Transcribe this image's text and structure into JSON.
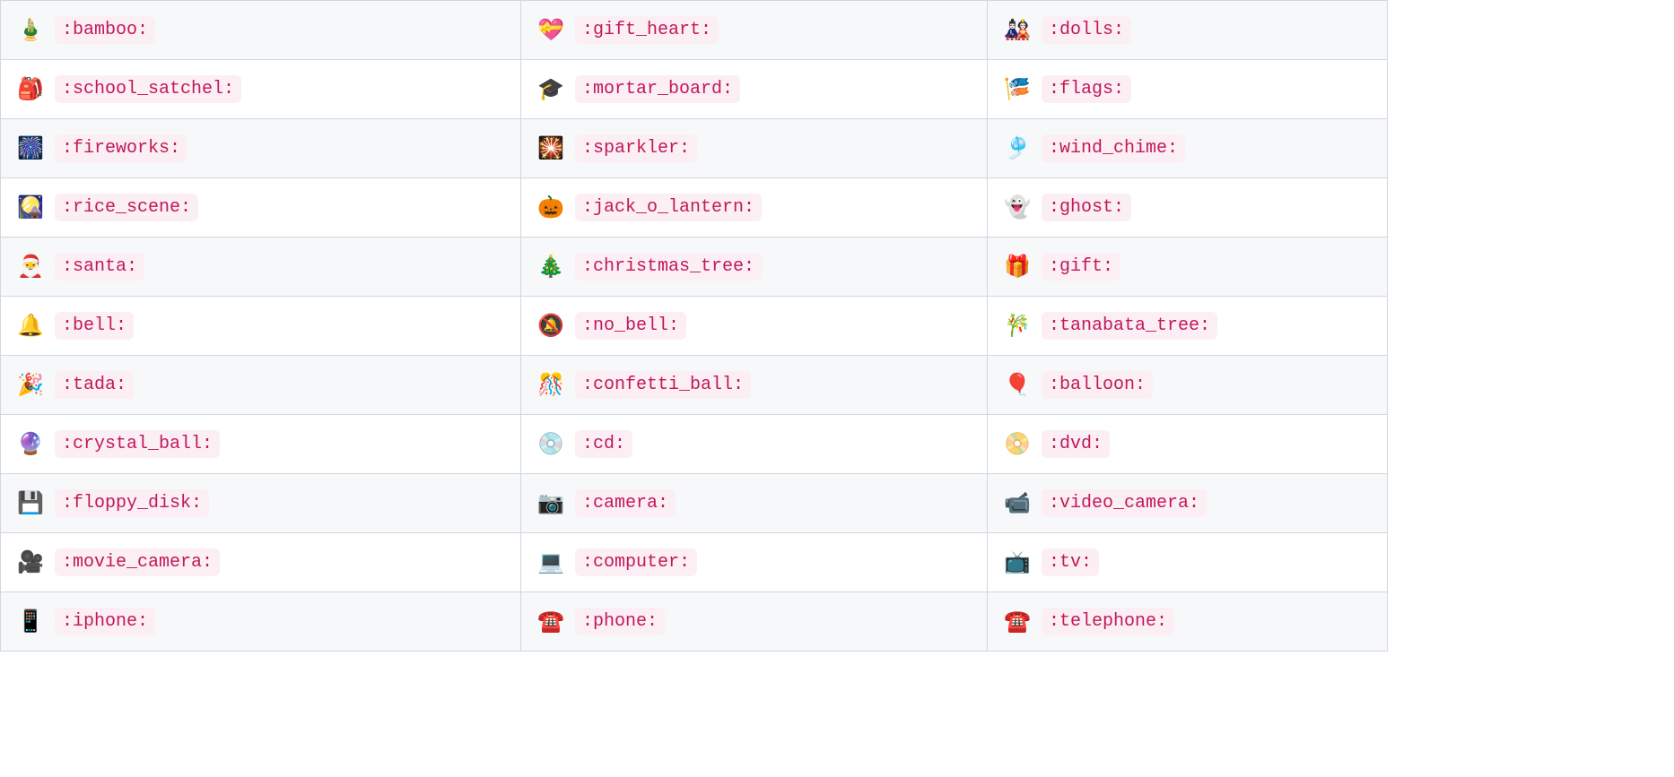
{
  "rows": [
    {
      "shade": "grey",
      "cells": [
        {
          "emoji": "🎍",
          "code": ":bamboo:",
          "name": "bamboo"
        },
        {
          "emoji": "💝",
          "code": ":gift_heart:",
          "name": "gift-heart"
        },
        {
          "emoji": "🎎",
          "code": ":dolls:",
          "name": "dolls"
        }
      ]
    },
    {
      "shade": "white",
      "cells": [
        {
          "emoji": "🎒",
          "code": ":school_satchel:",
          "name": "school-satchel"
        },
        {
          "emoji": "🎓",
          "code": ":mortar_board:",
          "name": "mortar-board"
        },
        {
          "emoji": "🎏",
          "code": ":flags:",
          "name": "flags"
        }
      ]
    },
    {
      "shade": "grey",
      "cells": [
        {
          "emoji": "🎆",
          "code": ":fireworks:",
          "name": "fireworks"
        },
        {
          "emoji": "🎇",
          "code": ":sparkler:",
          "name": "sparkler"
        },
        {
          "emoji": "🎐",
          "code": ":wind_chime:",
          "name": "wind-chime"
        }
      ]
    },
    {
      "shade": "white",
      "cells": [
        {
          "emoji": "🎑",
          "code": ":rice_scene:",
          "name": "rice-scene"
        },
        {
          "emoji": "🎃",
          "code": ":jack_o_lantern:",
          "name": "jack-o-lantern"
        },
        {
          "emoji": "👻",
          "code": ":ghost:",
          "name": "ghost"
        }
      ]
    },
    {
      "shade": "grey",
      "cells": [
        {
          "emoji": "🎅",
          "code": ":santa:",
          "name": "santa"
        },
        {
          "emoji": "🎄",
          "code": ":christmas_tree:",
          "name": "christmas-tree"
        },
        {
          "emoji": "🎁",
          "code": ":gift:",
          "name": "gift"
        }
      ]
    },
    {
      "shade": "white",
      "cells": [
        {
          "emoji": "🔔",
          "code": ":bell:",
          "name": "bell"
        },
        {
          "emoji": "🔕",
          "code": ":no_bell:",
          "name": "no-bell"
        },
        {
          "emoji": "🎋",
          "code": ":tanabata_tree:",
          "name": "tanabata-tree"
        }
      ]
    },
    {
      "shade": "grey",
      "cells": [
        {
          "emoji": "🎉",
          "code": ":tada:",
          "name": "tada"
        },
        {
          "emoji": "🎊",
          "code": ":confetti_ball:",
          "name": "confetti-ball"
        },
        {
          "emoji": "🎈",
          "code": ":balloon:",
          "name": "balloon"
        }
      ]
    },
    {
      "shade": "white",
      "cells": [
        {
          "emoji": "🔮",
          "code": ":crystal_ball:",
          "name": "crystal-ball"
        },
        {
          "emoji": "💿",
          "code": ":cd:",
          "name": "cd"
        },
        {
          "emoji": "📀",
          "code": ":dvd:",
          "name": "dvd"
        }
      ]
    },
    {
      "shade": "grey",
      "cells": [
        {
          "emoji": "💾",
          "code": ":floppy_disk:",
          "name": "floppy-disk"
        },
        {
          "emoji": "📷",
          "code": ":camera:",
          "name": "camera"
        },
        {
          "emoji": "📹",
          "code": ":video_camera:",
          "name": "video-camera"
        }
      ]
    },
    {
      "shade": "white",
      "cells": [
        {
          "emoji": "🎥",
          "code": ":movie_camera:",
          "name": "movie-camera"
        },
        {
          "emoji": "💻",
          "code": ":computer:",
          "name": "computer"
        },
        {
          "emoji": "📺",
          "code": ":tv:",
          "name": "tv"
        }
      ]
    },
    {
      "shade": "grey",
      "cells": [
        {
          "emoji": "📱",
          "code": ":iphone:",
          "name": "iphone"
        },
        {
          "emoji": "☎️",
          "code": ":phone:",
          "name": "phone"
        },
        {
          "emoji": "☎️",
          "code": ":telephone:",
          "name": "telephone"
        }
      ]
    }
  ]
}
